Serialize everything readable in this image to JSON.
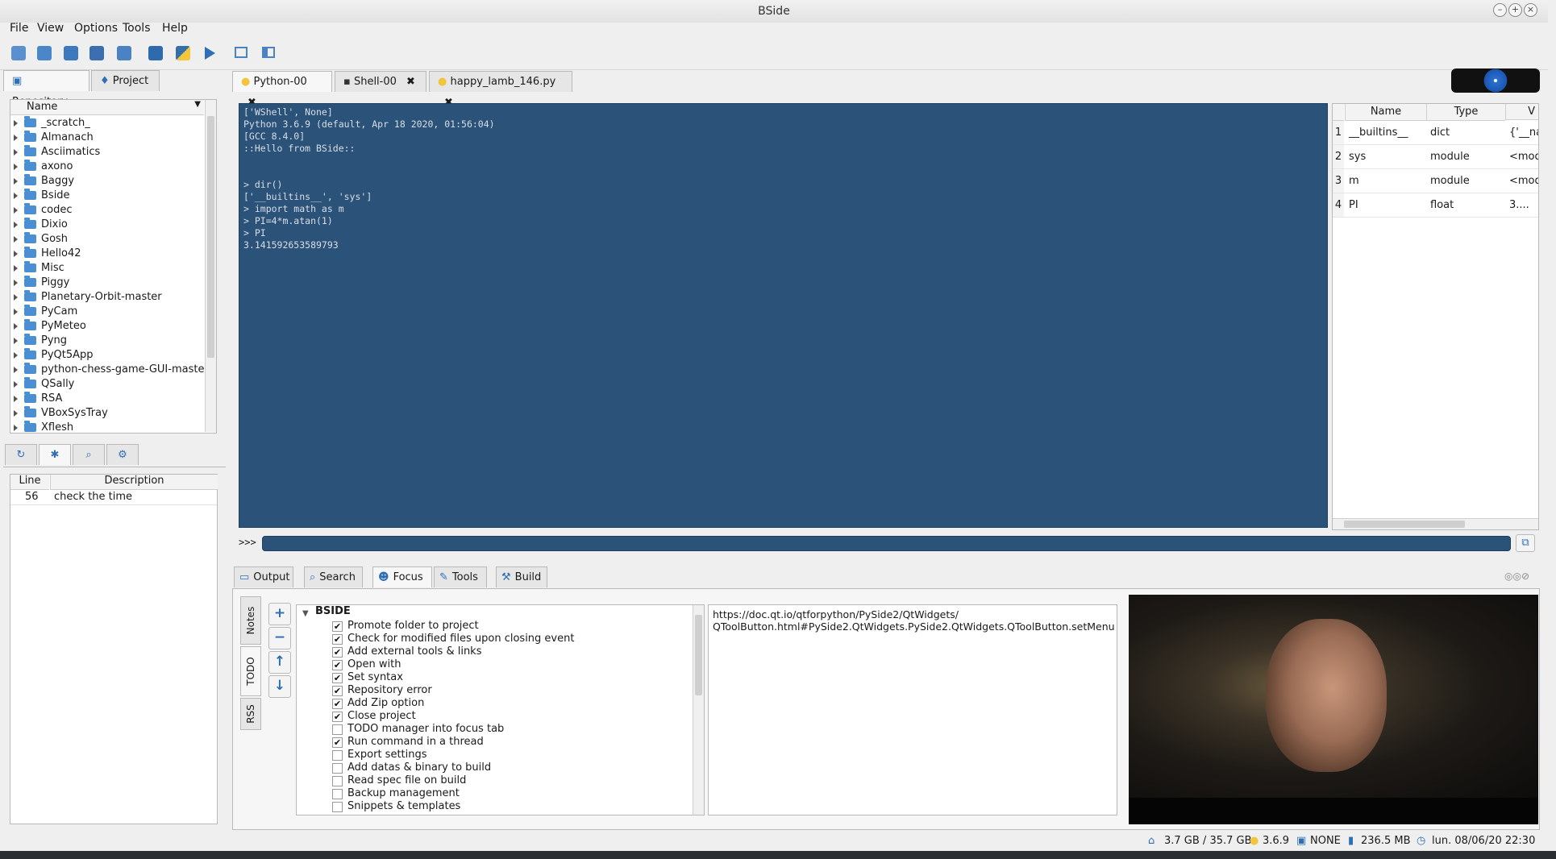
{
  "window": {
    "title": "BSide"
  },
  "menu": [
    "File",
    "View",
    "Options",
    "Tools",
    "Help"
  ],
  "left_tabs": {
    "repository": "Repository",
    "project": "Project"
  },
  "tree": {
    "header": "Name",
    "items": [
      "_scratch_",
      "Almanach",
      "Asciimatics",
      "axono",
      "Baggy",
      "Bside",
      "codec",
      "Dixio",
      "Gosh",
      "Hello42",
      "Misc",
      "Piggy",
      "Planetary-Orbit-master",
      "PyCam",
      "PyMeteo",
      "Pyng",
      "PyQt5App",
      "python-chess-game-GUI-master",
      "QSally",
      "RSA",
      "VBoxSysTray",
      "Xflesh"
    ]
  },
  "todo_table": {
    "columns": [
      "Line",
      "Description"
    ],
    "rows": [
      {
        "line": "56",
        "description": "check the time"
      }
    ]
  },
  "editor_tabs": [
    {
      "label": "Python-00",
      "close": "✖"
    },
    {
      "label": "Shell-00",
      "close": "✖"
    },
    {
      "label": "happy_lamb_146.py",
      "close": "✖"
    }
  ],
  "console": {
    "lines": [
      "['WShell', None]",
      "Python 3.6.9 (default, Apr 18 2020, 01:56:04)",
      "[GCC 8.4.0]",
      "::Hello from BSide::",
      "",
      "",
      "> dir()",
      "['__builtins__', 'sys']",
      "> import math as m",
      "> PI=4*m.atan(1)",
      "> PI",
      "3.141592653589793"
    ],
    "prompt": ">>>"
  },
  "variables": {
    "columns": [
      "Name",
      "Type",
      "V"
    ],
    "rows": [
      {
        "n": "1",
        "name": "__builtins__",
        "type": "dict",
        "value": "{'__nar"
      },
      {
        "n": "2",
        "name": "sys",
        "type": "module",
        "value": "<modu"
      },
      {
        "n": "3",
        "name": "m",
        "type": "module",
        "value": "<modu"
      },
      {
        "n": "4",
        "name": "PI",
        "type": "float",
        "value": "3...."
      }
    ]
  },
  "bottom_tabs": [
    "Output",
    "Search",
    "Focus",
    "Tools",
    "Build"
  ],
  "side_tabs": [
    "Notes",
    "TODO",
    "RSS"
  ],
  "todo": {
    "group": "BSIDE",
    "items": [
      {
        "label": "Promote folder to project",
        "checked": "✔"
      },
      {
        "label": "Check for modified files upon closing event",
        "checked": "✔"
      },
      {
        "label": "Add external tools & links",
        "checked": "✔"
      },
      {
        "label": "Open with",
        "checked": "✔"
      },
      {
        "label": "Set syntax",
        "checked": "✔"
      },
      {
        "label": "Repository error",
        "checked": "✔"
      },
      {
        "label": "Add Zip option",
        "checked": "✔"
      },
      {
        "label": "Close project",
        "checked": "✔"
      },
      {
        "label": "TODO manager into focus tab",
        "checked": ""
      },
      {
        "label": "Run command in a thread",
        "checked": "✔"
      },
      {
        "label": "Export settings",
        "checked": ""
      },
      {
        "label": "Add datas & binary to build",
        "checked": ""
      },
      {
        "label": "Read spec file on build",
        "checked": ""
      },
      {
        "label": "Backup management",
        "checked": ""
      },
      {
        "label": "Snippets & templates",
        "checked": ""
      }
    ]
  },
  "link_text": "https://doc.qt.io/qtforpython/PySide2/QtWidgets/\nQToolButton.html#PySide2.QtWidgets.PySide2.QtWidgets.QToolButton.setMenu",
  "statusbar": {
    "disk": "3.7 GB / 35.7 GB",
    "python": "3.6.9",
    "vcs": "NONE",
    "memory": "236.5 MB",
    "datetime": "lun. 08/06/20 22:30"
  },
  "colors": {
    "console_bg": "#2b5278",
    "accent": "#2e6fb6"
  }
}
